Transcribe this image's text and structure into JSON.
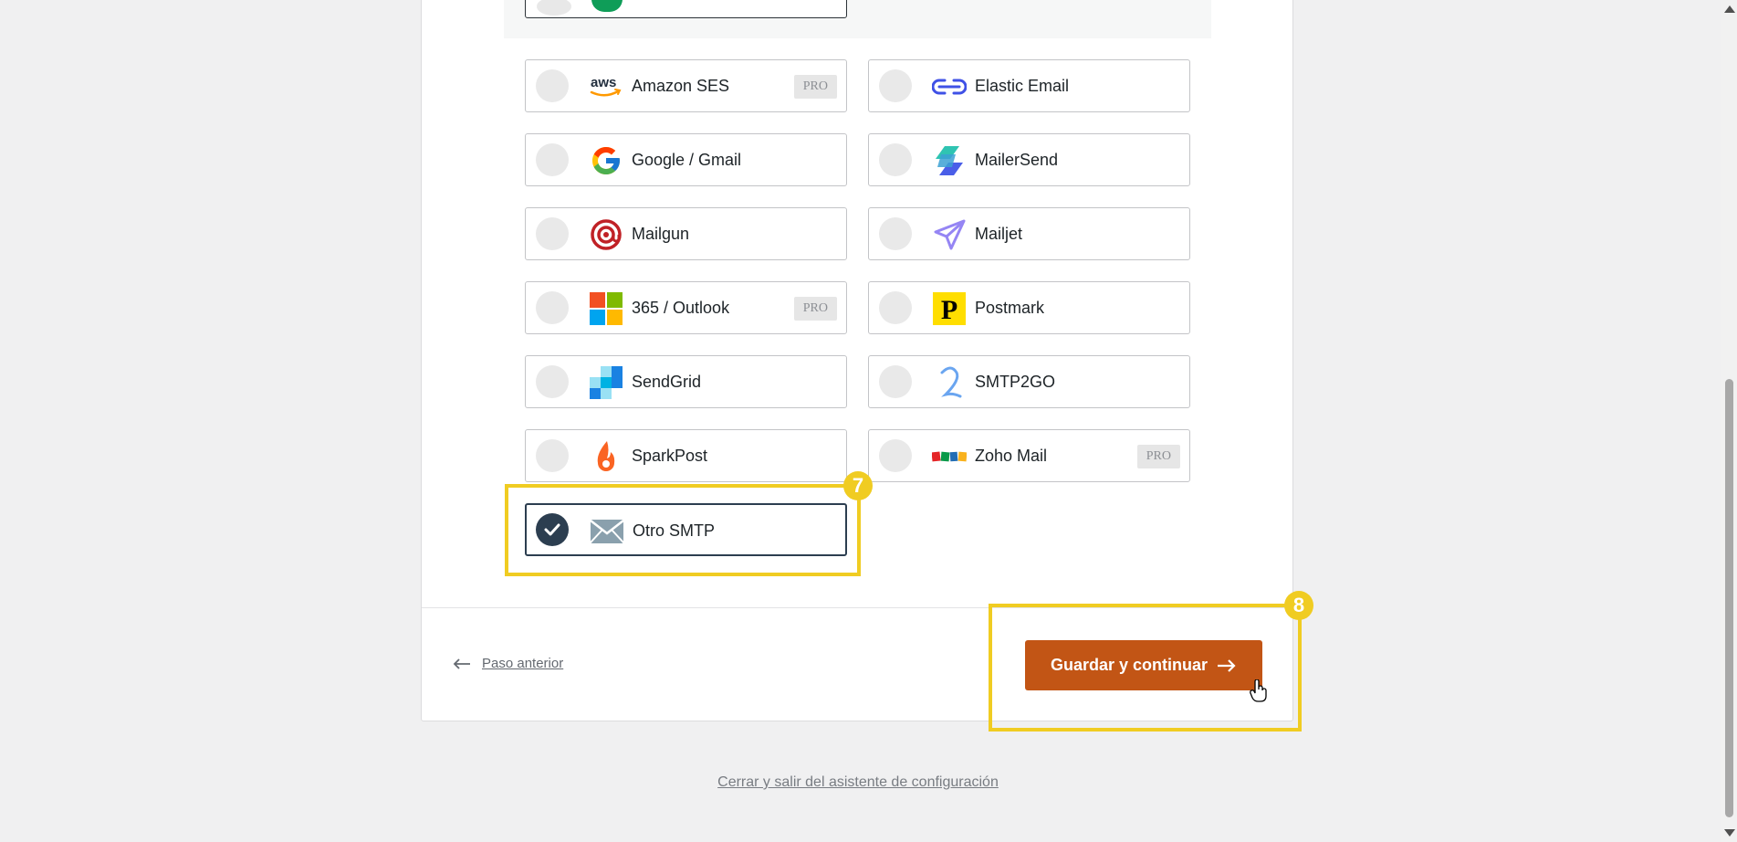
{
  "mailers": [
    {
      "id": "amazon-ses",
      "label": "Amazon SES",
      "pro": "PRO",
      "icon": "aws-icon"
    },
    {
      "id": "elastic-email",
      "label": "Elastic Email",
      "pro": null,
      "icon": "elastic-email-icon"
    },
    {
      "id": "google-gmail",
      "label": "Google / Gmail",
      "pro": null,
      "icon": "google-icon"
    },
    {
      "id": "mailersend",
      "label": "MailerSend",
      "pro": null,
      "icon": "mailersend-icon"
    },
    {
      "id": "mailgun",
      "label": "Mailgun",
      "pro": null,
      "icon": "mailgun-icon"
    },
    {
      "id": "mailjet",
      "label": "Mailjet",
      "pro": null,
      "icon": "mailjet-icon"
    },
    {
      "id": "outlook-365",
      "label": "365 / Outlook",
      "pro": "PRO",
      "icon": "microsoft-icon"
    },
    {
      "id": "postmark",
      "label": "Postmark",
      "pro": null,
      "icon": "postmark-icon"
    },
    {
      "id": "sendgrid",
      "label": "SendGrid",
      "pro": null,
      "icon": "sendgrid-icon"
    },
    {
      "id": "smtp2go",
      "label": "SMTP2GO",
      "pro": null,
      "icon": "smtp2go-icon"
    },
    {
      "id": "sparkpost",
      "label": "SparkPost",
      "pro": null,
      "icon": "sparkpost-icon"
    },
    {
      "id": "zoho-mail",
      "label": "Zoho Mail",
      "pro": "PRO",
      "icon": "zoho-icon"
    },
    {
      "id": "other-smtp",
      "label": "Otro SMTP",
      "pro": null,
      "icon": "envelope-icon",
      "selected": true
    }
  ],
  "annotations": {
    "step7": "7",
    "step8": "8",
    "color": "#f0cc22"
  },
  "footer": {
    "prev_label": "Paso anterior",
    "save_label": "Guardar y continuar",
    "exit_label": "Cerrar y salir del asistente de configuración"
  },
  "colors": {
    "primary_button": "#c25515",
    "selected_border": "#2c3e50"
  }
}
